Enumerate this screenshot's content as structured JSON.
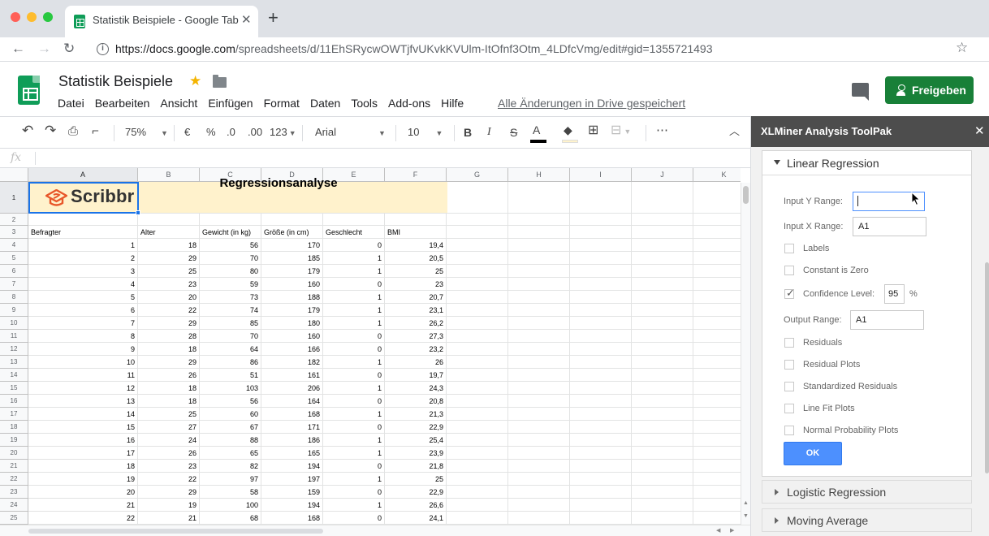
{
  "browser": {
    "tab_title": "Statistik Beispiele - Google Tabellen",
    "tab_close": "✕",
    "new_tab": "+",
    "url_host": "https://docs.google.com",
    "url_path": "/spreadsheets/d/11EhSRycwOWTjfvUKvkKVUlm-ItOfnf3Otm_4LDfcVmg/edit#gid=1355721493",
    "traffic_colors": [
      "#ff5f57",
      "#febc2e",
      "#28c840"
    ]
  },
  "doc": {
    "title": "Statistik Beispiele",
    "menu": [
      "Datei",
      "Bearbeiten",
      "Ansicht",
      "Einfügen",
      "Format",
      "Daten",
      "Tools",
      "Add-ons",
      "Hilfe"
    ],
    "saved_status": "Alle Änderungen in Drive gespeichert",
    "share_label": "Freigeben",
    "accent_color": "#188038"
  },
  "toolbar": {
    "zoom": "75%",
    "currency": "€",
    "percent": "%",
    "decrease_decimals": ".0",
    "increase_decimals": ".00",
    "more_formats": "123",
    "font": "Arial",
    "font_size": "10",
    "bold": "B",
    "italic": "I",
    "strike": "S",
    "text_color": "A"
  },
  "formula_bar": {
    "fx": "fx"
  },
  "grid": {
    "columns": [
      "A",
      "B",
      "C",
      "D",
      "E",
      "F",
      "G",
      "H",
      "I",
      "J",
      "K"
    ],
    "banner_title": "Regressionsanalyse",
    "logo_text": "Scribbr",
    "headers": [
      "Befragter",
      "Alter",
      "Gewicht (in kg)",
      "Größe (in cm)",
      "Geschlecht",
      "BMI"
    ],
    "rows": [
      [
        "1",
        "18",
        "56",
        "170",
        "0",
        "19,4"
      ],
      [
        "2",
        "29",
        "70",
        "185",
        "1",
        "20,5"
      ],
      [
        "3",
        "25",
        "80",
        "179",
        "1",
        "25"
      ],
      [
        "4",
        "23",
        "59",
        "160",
        "0",
        "23"
      ],
      [
        "5",
        "20",
        "73",
        "188",
        "1",
        "20,7"
      ],
      [
        "6",
        "22",
        "74",
        "179",
        "1",
        "23,1"
      ],
      [
        "7",
        "29",
        "85",
        "180",
        "1",
        "26,2"
      ],
      [
        "8",
        "28",
        "70",
        "160",
        "0",
        "27,3"
      ],
      [
        "9",
        "18",
        "64",
        "166",
        "0",
        "23,2"
      ],
      [
        "10",
        "29",
        "86",
        "182",
        "1",
        "26"
      ],
      [
        "11",
        "26",
        "51",
        "161",
        "0",
        "19,7"
      ],
      [
        "12",
        "18",
        "103",
        "206",
        "1",
        "24,3"
      ],
      [
        "13",
        "18",
        "56",
        "164",
        "0",
        "20,8"
      ],
      [
        "14",
        "25",
        "60",
        "168",
        "1",
        "21,3"
      ],
      [
        "15",
        "27",
        "67",
        "171",
        "0",
        "22,9"
      ],
      [
        "16",
        "24",
        "88",
        "186",
        "1",
        "25,4"
      ],
      [
        "17",
        "26",
        "65",
        "165",
        "1",
        "23,9"
      ],
      [
        "18",
        "23",
        "82",
        "194",
        "0",
        "21,8"
      ],
      [
        "19",
        "22",
        "97",
        "197",
        "1",
        "25"
      ],
      [
        "20",
        "29",
        "58",
        "159",
        "0",
        "22,9"
      ],
      [
        "21",
        "19",
        "100",
        "194",
        "1",
        "26,6"
      ],
      [
        "22",
        "21",
        "68",
        "168",
        "0",
        "24,1"
      ]
    ]
  },
  "panel": {
    "title": "XLMiner Analysis ToolPak",
    "close": "✕",
    "section_title": "Linear Regression",
    "input_y_label": "Input Y Range:",
    "input_y_value": "",
    "input_x_label": "Input X Range:",
    "input_x_value": "A1",
    "labels": "Labels",
    "constant_zero": "Constant is Zero",
    "confidence_label": "Confidence Level:",
    "confidence_value": "95",
    "confidence_unit": "%",
    "output_label": "Output Range:",
    "output_value": "A1",
    "residuals": "Residuals",
    "residual_plots": "Residual Plots",
    "standardized_residuals": "Standardized Residuals",
    "line_fit_plots": "Line Fit Plots",
    "normal_probability_plots": "Normal Probability Plots",
    "ok": "OK",
    "logistic_regression": "Logistic Regression",
    "moving_average": "Moving Average"
  }
}
